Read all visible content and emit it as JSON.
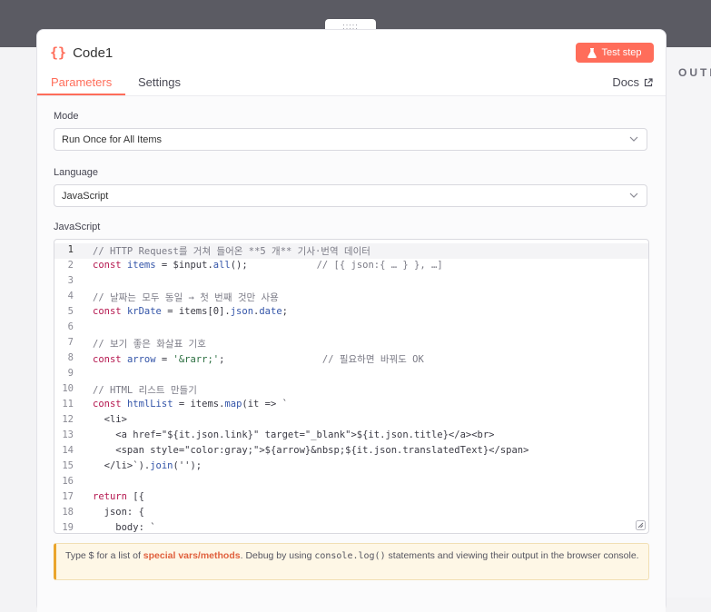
{
  "drag_handle": ":::::",
  "node": {
    "icon": "{}",
    "title": "Code1",
    "test_label": "Test step"
  },
  "tabs": {
    "parameters": "Parameters",
    "settings": "Settings",
    "docs": "Docs"
  },
  "output_label": "OUTPUT",
  "mode": {
    "label": "Mode",
    "value": "Run Once for All Items"
  },
  "language": {
    "label": "Language",
    "value": "JavaScript"
  },
  "editor": {
    "label": "JavaScript",
    "active_line": 1
  },
  "code_lines": [
    {
      "n": "1",
      "tokens": [
        {
          "c": "cm",
          "t": "// HTTP Request를 거쳐 들어온 **5 개** 기사·번역 데이터"
        }
      ]
    },
    {
      "n": "2",
      "tokens": [
        {
          "c": "kw",
          "t": "const "
        },
        {
          "c": "fn",
          "t": "items"
        },
        {
          "c": "",
          "t": " = $input."
        },
        {
          "c": "fn",
          "t": "all"
        },
        {
          "c": "",
          "t": "();            "
        },
        {
          "c": "cm",
          "t": "// [{ json:{ … } }, …]"
        }
      ]
    },
    {
      "n": "3",
      "tokens": []
    },
    {
      "n": "4",
      "tokens": [
        {
          "c": "cm",
          "t": "// 날짜는 모두 동일 → 첫 번째 것만 사용"
        }
      ]
    },
    {
      "n": "5",
      "tokens": [
        {
          "c": "kw",
          "t": "const "
        },
        {
          "c": "fn",
          "t": "krDate"
        },
        {
          "c": "",
          "t": " = items[0]."
        },
        {
          "c": "fn",
          "t": "json"
        },
        {
          "c": "",
          "t": "."
        },
        {
          "c": "fn",
          "t": "date"
        },
        {
          "c": "",
          "t": ";"
        }
      ]
    },
    {
      "n": "6",
      "tokens": []
    },
    {
      "n": "7",
      "tokens": [
        {
          "c": "cm",
          "t": "// 보기 좋은 화살표 기호"
        }
      ]
    },
    {
      "n": "8",
      "tokens": [
        {
          "c": "kw",
          "t": "const "
        },
        {
          "c": "fn",
          "t": "arrow"
        },
        {
          "c": "",
          "t": " = "
        },
        {
          "c": "str",
          "t": "'&rarr;'"
        },
        {
          "c": "",
          "t": ";                 "
        },
        {
          "c": "cm",
          "t": "// 필요하면 바꿔도 OK"
        }
      ]
    },
    {
      "n": "9",
      "tokens": []
    },
    {
      "n": "10",
      "tokens": [
        {
          "c": "cm",
          "t": "// HTML 리스트 만들기"
        }
      ]
    },
    {
      "n": "11",
      "tokens": [
        {
          "c": "kw",
          "t": "const "
        },
        {
          "c": "fn",
          "t": "htmlList"
        },
        {
          "c": "",
          "t": " = items."
        },
        {
          "c": "fn",
          "t": "map"
        },
        {
          "c": "",
          "t": "(it => `"
        }
      ]
    },
    {
      "n": "12",
      "tokens": [
        {
          "c": "",
          "t": "  <li>"
        }
      ]
    },
    {
      "n": "13",
      "tokens": [
        {
          "c": "",
          "t": "    <a href=\"${it.json.link}\" target=\"_blank\">${it.json.title}</a><br>"
        }
      ]
    },
    {
      "n": "14",
      "tokens": [
        {
          "c": "",
          "t": "    <span style=\"color:gray;\">${arrow}&nbsp;${it.json.translatedText}</span>"
        }
      ]
    },
    {
      "n": "15",
      "tokens": [
        {
          "c": "",
          "t": "  </li>`)."
        },
        {
          "c": "fn",
          "t": "join"
        },
        {
          "c": "",
          "t": "('');"
        }
      ]
    },
    {
      "n": "16",
      "tokens": []
    },
    {
      "n": "17",
      "tokens": [
        {
          "c": "kw",
          "t": "return "
        },
        {
          "c": "",
          "t": "[{"
        }
      ]
    },
    {
      "n": "18",
      "tokens": [
        {
          "c": "",
          "t": "  json: {"
        }
      ]
    },
    {
      "n": "19",
      "tokens": [
        {
          "c": "",
          "t": "    body: `"
        }
      ]
    }
  ],
  "hint": {
    "before": "Type $ for a list of ",
    "link": "special vars/methods",
    "middle": ". Debug by using ",
    "code": "console.log()",
    "after": " statements and viewing their output in the browser console."
  },
  "colors": {
    "accent": "#ff6d5a",
    "hint_bg": "#fef7e6",
    "hint_border": "#eaa52c"
  },
  "icons": [
    "code-braces-icon",
    "flask-icon",
    "external-link-icon",
    "chevron-down-icon",
    "resize-handle-icon"
  ]
}
